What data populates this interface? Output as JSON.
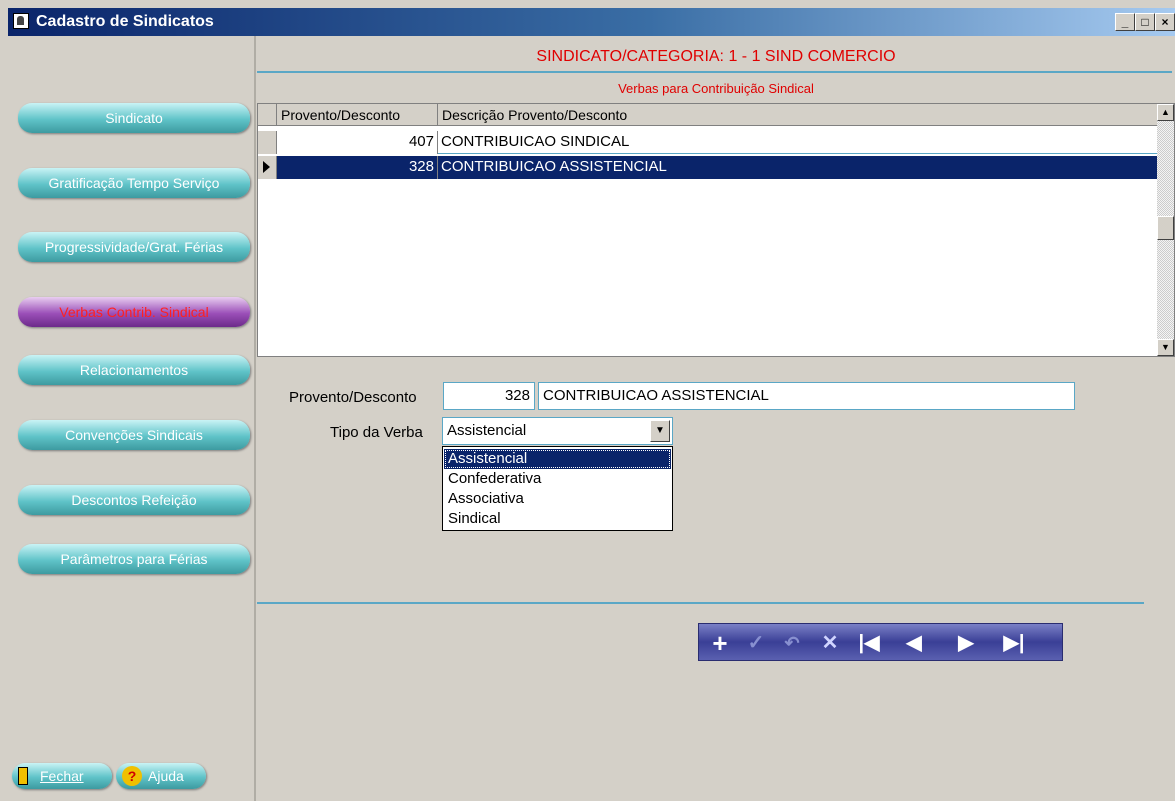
{
  "window": {
    "title": "Cadastro de Sindicatos",
    "min": "_",
    "max": "□",
    "close": "×"
  },
  "header": {
    "sindicato": "SINDICATO/CATEGORIA: 1 - 1 SIND COMERCIO",
    "subtitle": "Verbas para Contribuição Sindical"
  },
  "sidebar": {
    "items": [
      {
        "label": "Sindicato"
      },
      {
        "label": "Gratificação Tempo Serviço"
      },
      {
        "label": "Progressividade/Grat. Férias"
      },
      {
        "label": "Verbas Contrib. Sindical"
      },
      {
        "label": "Relacionamentos"
      },
      {
        "label": "Convenções Sindicais"
      },
      {
        "label": "Descontos Refeição"
      },
      {
        "label": "Parâmetros para Férias"
      }
    ],
    "fechar": "Fechar",
    "ajuda": "Ajuda"
  },
  "grid": {
    "columns": [
      "Provento/Desconto",
      "Descrição Provento/Desconto"
    ],
    "rows": [
      {
        "code": "407",
        "desc": "CONTRIBUICAO SINDICAL"
      },
      {
        "code": "328",
        "desc": "CONTRIBUICAO ASSISTENCIAL"
      }
    ]
  },
  "form": {
    "provento_label": "Provento/Desconto",
    "provento_code": "328",
    "provento_desc": "CONTRIBUICAO ASSISTENCIAL",
    "tipo_label": "Tipo da Verba",
    "tipo_value": "Assistencial",
    "tipo_options": [
      "Assistencial",
      "Confederativa",
      "Associativa",
      "Sindical"
    ]
  },
  "colors": {
    "accent": "#5aa7c6",
    "selection": "#0a246a",
    "red": "#e00000"
  },
  "nav_icons": [
    "plus-icon",
    "check-icon",
    "undo-icon",
    "cancel-icon",
    "first-icon",
    "prev-icon",
    "next-icon",
    "last-icon"
  ]
}
